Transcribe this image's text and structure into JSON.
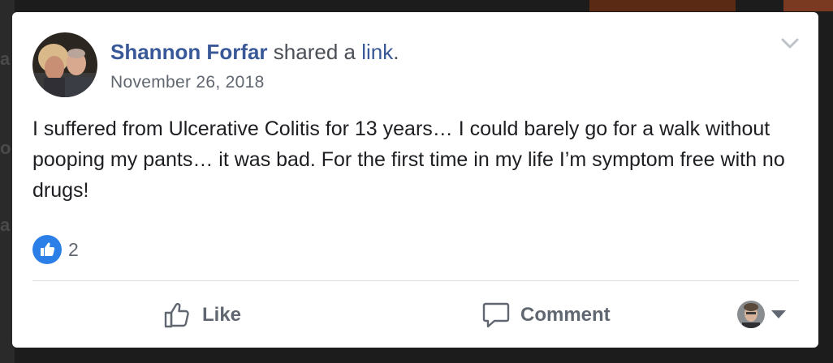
{
  "post": {
    "author": "Shannon Forfar",
    "action_text": "shared a",
    "link_text": "link",
    "period": ".",
    "date": "November 26, 2018",
    "text": "I suffered from Ulcerative Colitis for 13 years… I could barely go for a walk without pooping my pants… it was bad. For the first time in my life I’m symptom free with no drugs!"
  },
  "reactions": {
    "icon": "like-icon",
    "count": "2",
    "color": "#2d7fe8"
  },
  "actions": {
    "like_label": "Like",
    "comment_label": "Comment"
  },
  "colors": {
    "author_link": "#385898",
    "muted_text": "#606770",
    "body_text": "#1c1e21"
  }
}
